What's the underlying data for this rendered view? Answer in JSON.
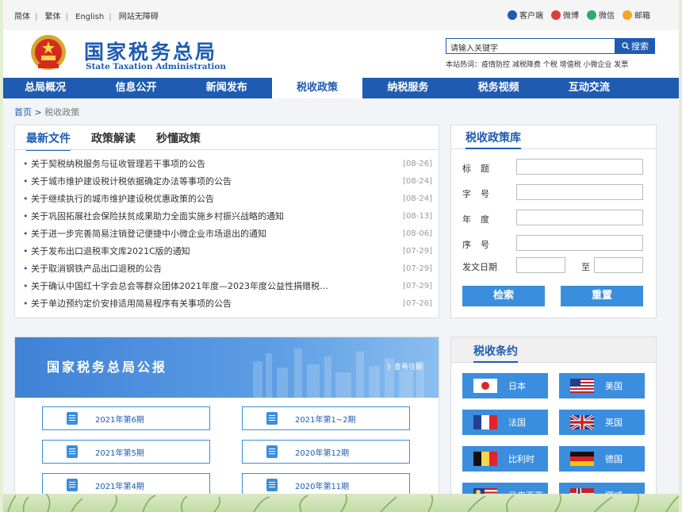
{
  "top": {
    "links": [
      "简体",
      "繁体",
      "English",
      "网站无障碍"
    ],
    "social": [
      {
        "label": "客户端",
        "icon": "client-icon",
        "color": "#1e5bb1"
      },
      {
        "label": "微博",
        "icon": "weibo-icon",
        "color": "#e03c3c"
      },
      {
        "label": "微信",
        "icon": "wechat-icon",
        "color": "#2aae67"
      },
      {
        "label": "邮箱",
        "icon": "mail-icon",
        "color": "#f5a623"
      }
    ]
  },
  "header": {
    "title_cn": "国家税务总局",
    "title_en": "State Taxation Administration",
    "search_placeholder": "请输入关键字",
    "search_button": "搜索",
    "hot_words": "本站热词：疫情防控 减税降费 个税 增值税 小微企业 发票"
  },
  "nav": [
    "总局概况",
    "信息公开",
    "新闻发布",
    "税收政策",
    "纳税服务",
    "税务视频",
    "互动交流"
  ],
  "nav_active": 3,
  "breadcrumb": {
    "home": "首页",
    "sep": " > ",
    "current": "税收政策"
  },
  "news": {
    "tabs": [
      "最新文件",
      "政策解读",
      "秒懂政策"
    ],
    "items": [
      {
        "title": "关于契税纳税服务与征收管理若干事项的公告",
        "date": "[08-26]"
      },
      {
        "title": "关于城市维护建设税计税依据确定办法等事项的公告",
        "date": "[08-24]"
      },
      {
        "title": "关于继续执行的城市维护建设税优惠政策的公告",
        "date": "[08-24]"
      },
      {
        "title": "关于巩固拓展社会保险扶贫成果助力全面实施乡村振兴战略的通知",
        "date": "[08-13]"
      },
      {
        "title": "关于进一步完善简易注销登记便捷中小微企业市场退出的通知",
        "date": "[08-06]"
      },
      {
        "title": "关于发布出口退税率文库2021C版的通知",
        "date": "[07-29]"
      },
      {
        "title": "关于取消钢铁产品出口退税的公告",
        "date": "[07-29]"
      },
      {
        "title": "关于确认中国红十字会总会等群众团体2021年度—2023年度公益性捐赠税…",
        "date": "[07-29]"
      },
      {
        "title": "关于单边预约定价安排适用简易程序有关事项的公告",
        "date": "[07-26]"
      }
    ]
  },
  "policy_db": {
    "title": "税收政策库",
    "fields": {
      "title": "标题",
      "number": "字号",
      "year": "年度",
      "serial": "序号",
      "date": "发文日期",
      "to": "至"
    },
    "search": "检索",
    "reset": "重置"
  },
  "gazette": {
    "title": "国家税务总局公报",
    "more": "》查看往期",
    "issues": [
      "2021年第6期",
      "2021年第1~2期",
      "2021年第5期",
      "2020年第12期",
      "2021年第4期",
      "2020年第11期"
    ]
  },
  "treaty": {
    "title": "税收条约",
    "countries": [
      {
        "name": "日本",
        "flag": "japan-flag-icon"
      },
      {
        "name": "美国",
        "flag": "usa-flag-icon"
      },
      {
        "name": "法国",
        "flag": "france-flag-icon"
      },
      {
        "name": "英国",
        "flag": "uk-flag-icon"
      },
      {
        "name": "比利时",
        "flag": "belgium-flag-icon"
      },
      {
        "name": "德国",
        "flag": "germany-flag-icon"
      },
      {
        "name": "马来西亚",
        "flag": "malaysia-flag-icon"
      },
      {
        "name": "挪威",
        "flag": "norway-flag-icon"
      }
    ]
  }
}
